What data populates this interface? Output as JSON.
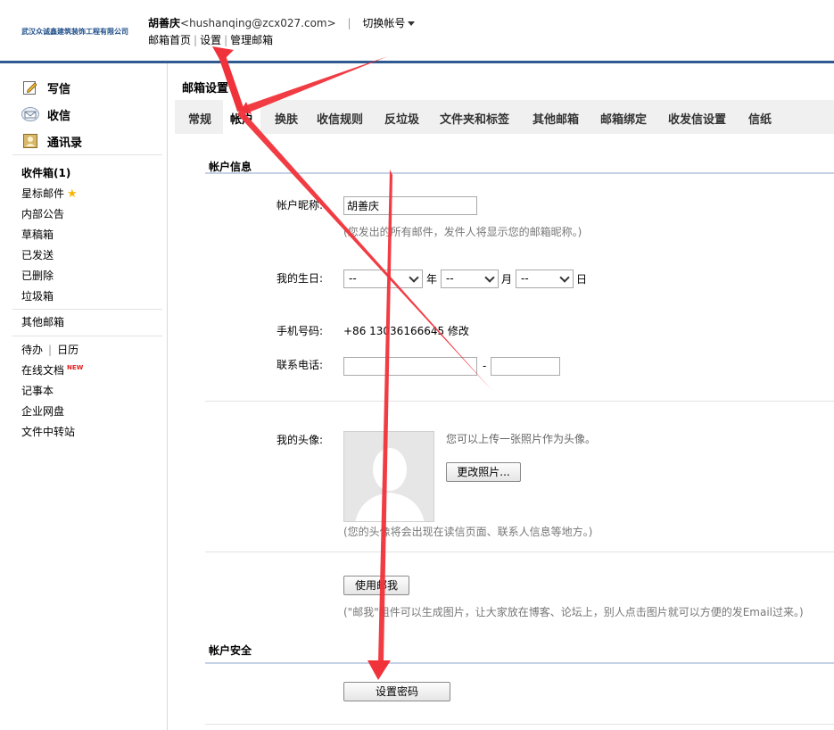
{
  "header": {
    "company_logo_text": "武汉众诚鑫建筑装饰工程有限公司",
    "user_name": "胡善庆",
    "user_email": "<hushanqing@zcx027.com>",
    "separator": "|",
    "switch_account": "切换帐号",
    "links": {
      "home": "邮箱首页",
      "settings": "设置",
      "manage": "管理邮箱",
      "sep": "|"
    }
  },
  "sidebar": {
    "main_items": [
      {
        "label": "写信",
        "icon": "pencil-icon"
      },
      {
        "label": "收信",
        "icon": "envelope-icon"
      },
      {
        "label": "通讯录",
        "icon": "contacts-icon"
      }
    ],
    "folders": [
      {
        "label": "收件箱(1)"
      },
      {
        "label": "星标邮件"
      },
      {
        "label": "内部公告"
      },
      {
        "label": "草稿箱"
      },
      {
        "label": "已发送"
      },
      {
        "label": "已删除"
      },
      {
        "label": "垃圾箱"
      }
    ],
    "other_mail": "其他邮箱",
    "tools": {
      "todo": "待办",
      "calendar": "日历",
      "sep": "|",
      "online_docs": "在线文档",
      "new_badge": "NEW",
      "notes": "记事本",
      "netdisk": "企业网盘",
      "transfer": "文件中转站"
    }
  },
  "main": {
    "page_title": "邮箱设置",
    "tabs": [
      {
        "label": "常规"
      },
      {
        "label": "帐户"
      },
      {
        "label": "换肤"
      },
      {
        "label": "收信规则"
      },
      {
        "label": "反垃圾"
      },
      {
        "label": "文件夹和标签"
      },
      {
        "label": "其他邮箱"
      },
      {
        "label": "邮箱绑定"
      },
      {
        "label": "收发信设置"
      },
      {
        "label": "信纸"
      }
    ],
    "account_info": {
      "section_title": "帐户信息",
      "nickname_label": "帐户昵称:",
      "nickname_value": "胡善庆",
      "nickname_hint": "(您发出的所有邮件，发件人将显示您的邮箱昵称。)",
      "birthday_label": "我的生日:",
      "birthday_year": "--",
      "year_unit": "年",
      "birthday_month": "--",
      "month_unit": "月",
      "birthday_day": "--",
      "day_unit": "日",
      "phone_label": "手机号码:",
      "phone_value": "+86 13036166645 修改",
      "tel_label": "联系电话:",
      "tel_dash": "-",
      "avatar_label": "我的头像:",
      "avatar_hint": "您可以上传一张照片作为头像。",
      "change_photo_button": "更改照片...",
      "avatar_note": "(您的头像将会出现在读信页面、联系人信息等地方。)",
      "use_mail_me_button": "使用邮我",
      "mail_me_note": "(\"邮我\"组件可以生成图片，让大家放在博客、论坛上，别人点击图片就可以方便的发Email过来。)"
    },
    "account_security": {
      "section_title": "帐户安全",
      "set_password_button": "设置密码"
    }
  },
  "colors": {
    "header_rule": "#2f5a91",
    "section_rule": "#c5d2e6",
    "annotation_arrow": "#f0323a",
    "new_badge": "#e02020",
    "star": "#f5b700"
  }
}
